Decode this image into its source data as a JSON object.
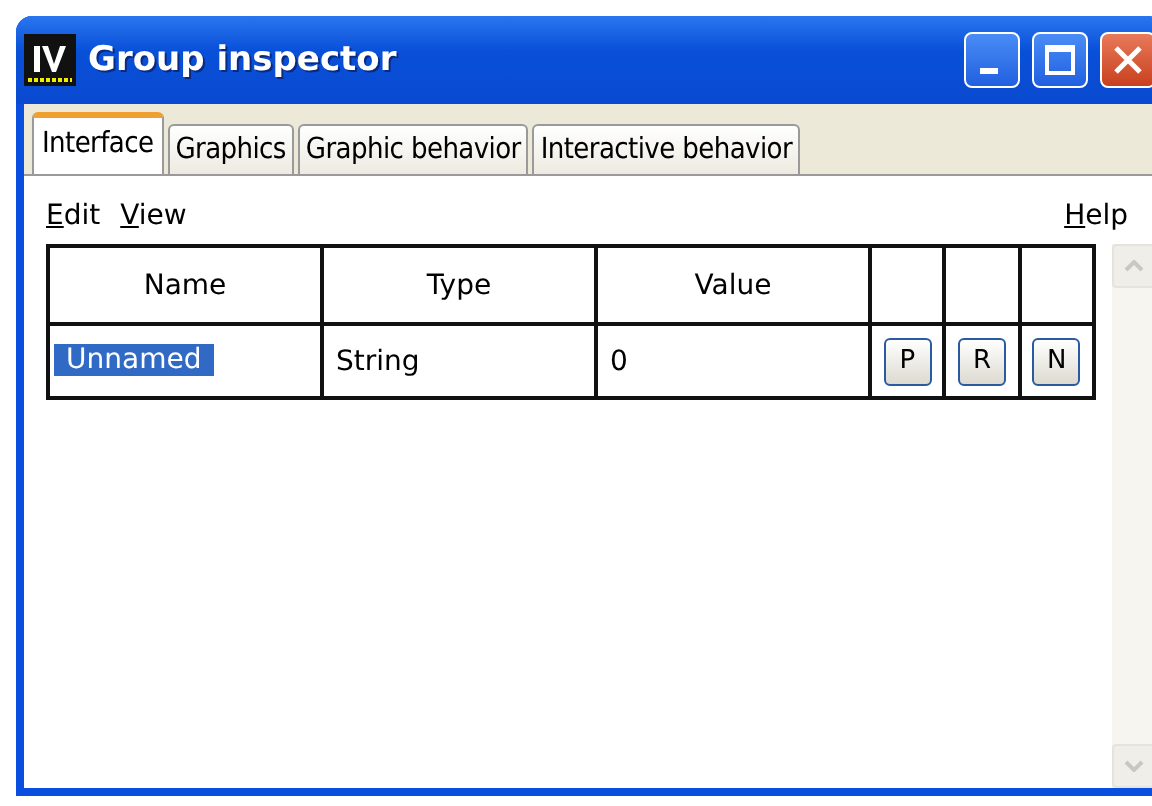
{
  "window": {
    "title": "Group inspector"
  },
  "tabs": [
    {
      "label": "Interface",
      "selected": true
    },
    {
      "label": "Graphics",
      "selected": false
    },
    {
      "label": "Graphic behavior",
      "selected": false
    },
    {
      "label": "Interactive behavior",
      "selected": false
    }
  ],
  "menu": {
    "left": [
      "Edit",
      "View"
    ],
    "right": [
      "Help"
    ]
  },
  "table": {
    "columns": [
      "Name",
      "Type",
      "Value"
    ],
    "rows": [
      {
        "name": "Unnamed",
        "type": "String",
        "value": "0",
        "selected": true,
        "buttons": [
          "P",
          "R",
          "N"
        ]
      }
    ]
  }
}
